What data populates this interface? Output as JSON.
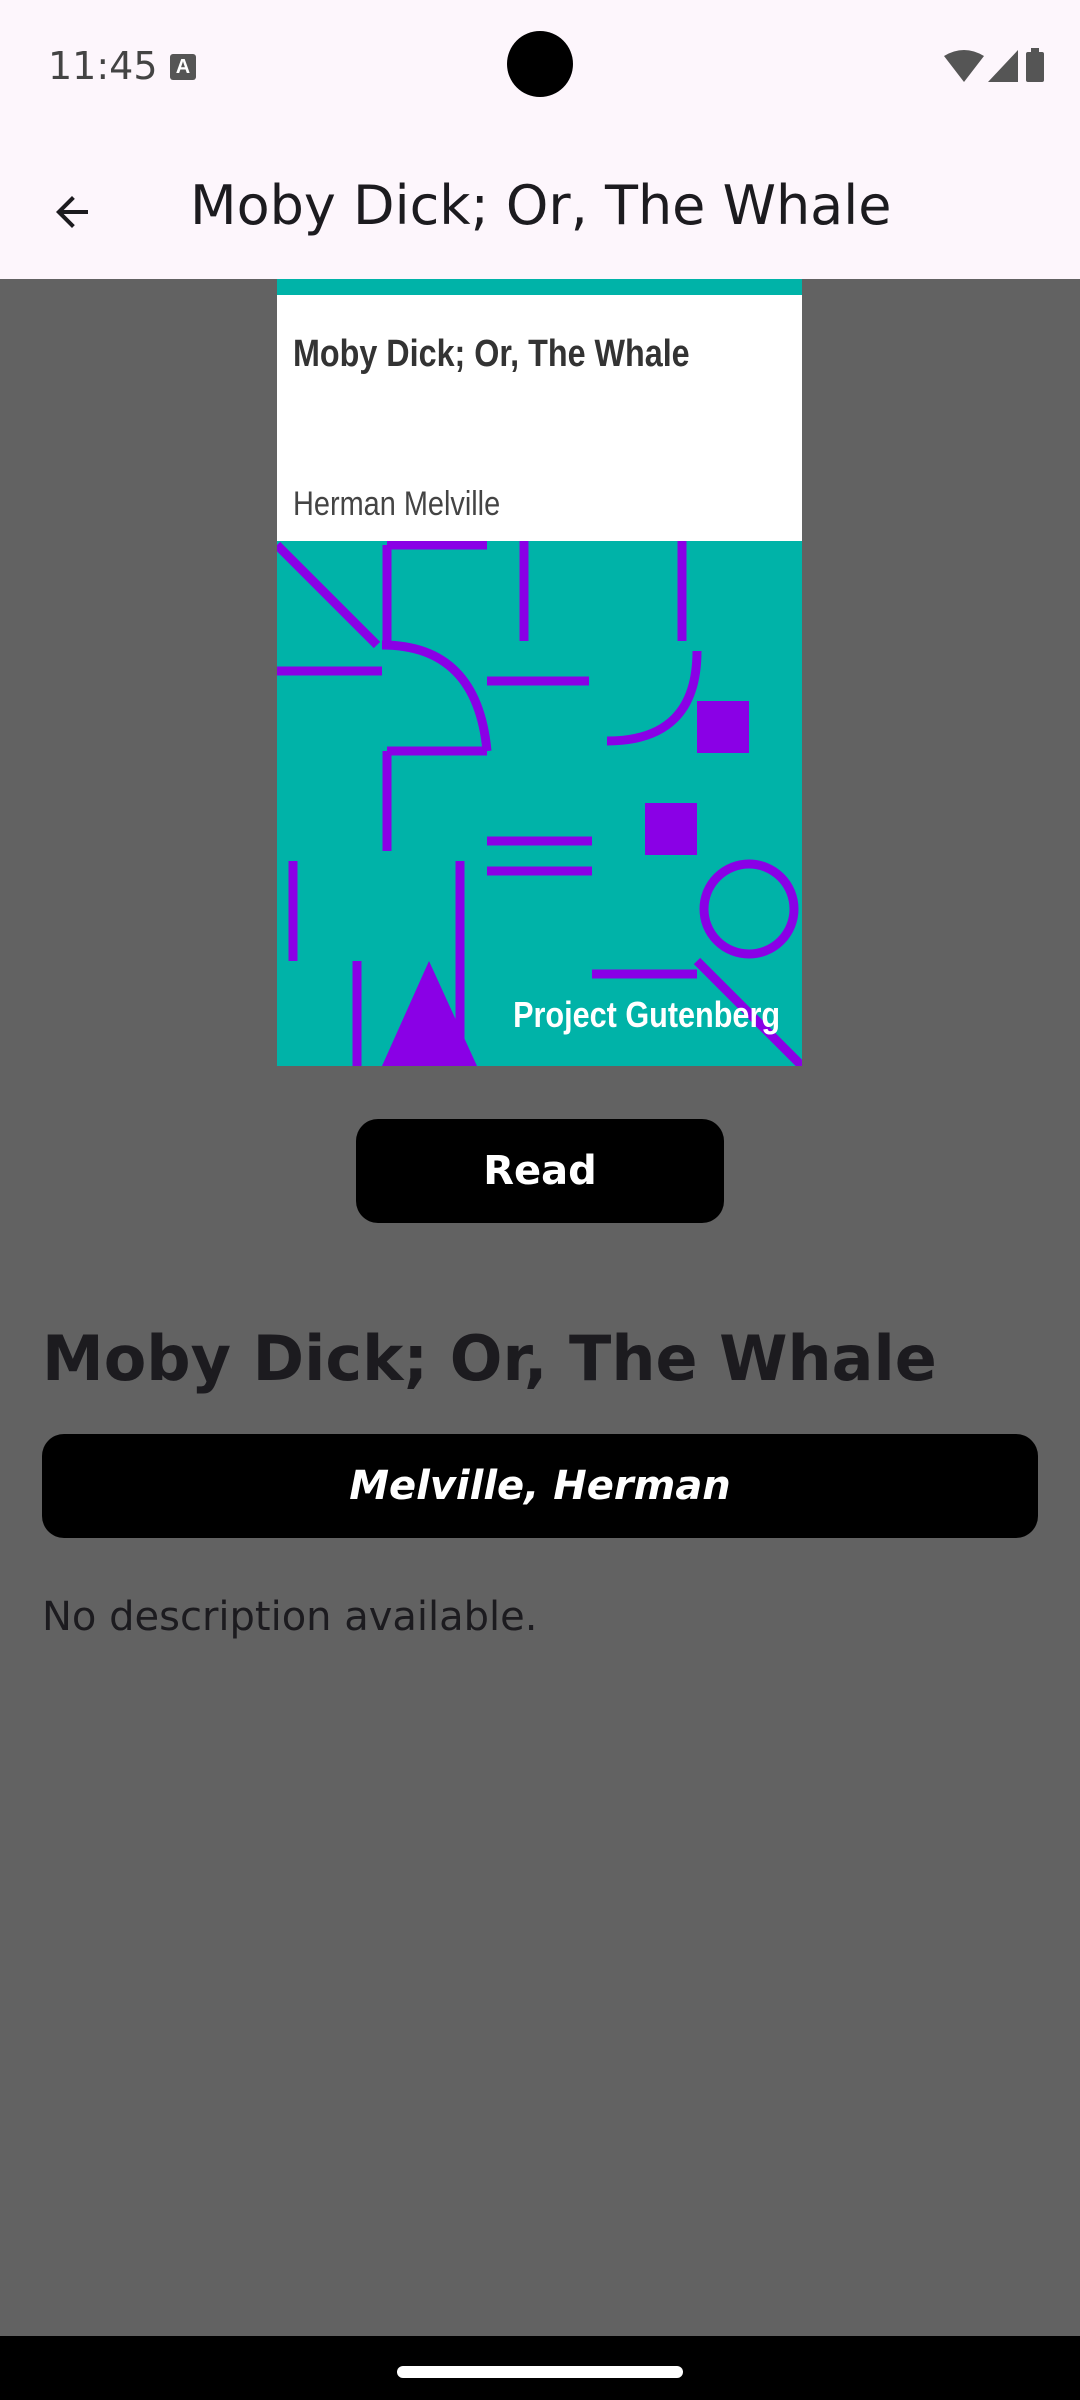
{
  "status_bar": {
    "time": "11:45",
    "notification_icon": "A",
    "icons": [
      "wifi-icon",
      "signal-icon",
      "battery-icon"
    ]
  },
  "app_bar": {
    "title": "Moby Dick; Or, The Whale",
    "back_icon": "arrow-back-icon"
  },
  "cover": {
    "title": "Moby Dick; Or, The Whale",
    "author": "Herman Melville",
    "publisher": "Project Gutenberg",
    "colors": {
      "background": "#00b3a8",
      "shapes": "#8a00e6",
      "panel": "#ffffff"
    }
  },
  "actions": {
    "read_label": "Read"
  },
  "book": {
    "title": "Moby Dick; Or, The Whale",
    "author": "Melville, Herman",
    "description": "No description available."
  }
}
